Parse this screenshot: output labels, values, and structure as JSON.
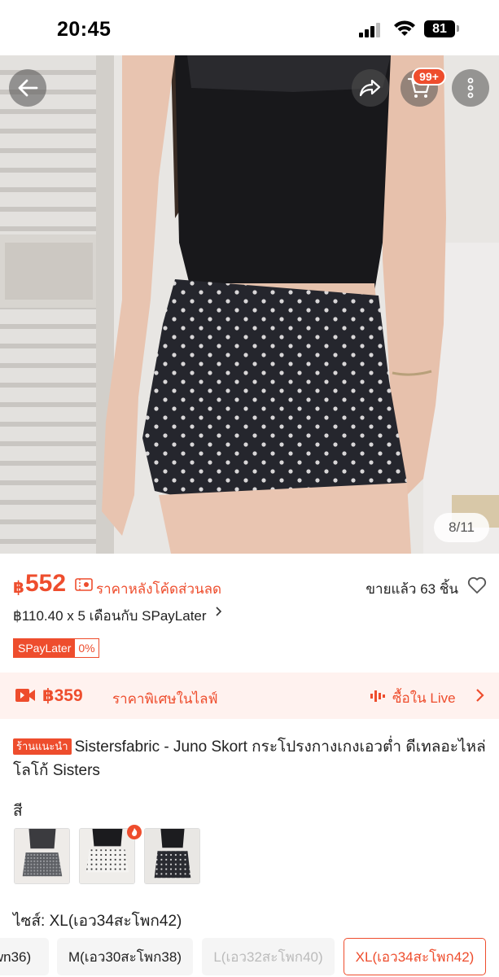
{
  "status_bar": {
    "time": "20:45",
    "battery": "81"
  },
  "header": {
    "back_icon": "arrow-left-icon",
    "share_icon": "share-icon",
    "cart_icon": "cart-icon",
    "cart_badge": "99+",
    "more_icon": "more-vertical-icon"
  },
  "gallery": {
    "indicator": "8/11"
  },
  "price": {
    "currency": "฿",
    "amount": "552",
    "note": "ราคาหลังโค้ดส่วนลด",
    "sold": "ขายแล้ว 63 ชิ้น",
    "installment": "฿110.40 x 5 เดือนกับ SPayLater",
    "spay_label": "SPayLater",
    "spay_rate": "0%"
  },
  "live": {
    "price": "฿359",
    "note": "ราคาพิเศษในไลฟ์",
    "cta": "ซื้อใน Live"
  },
  "product": {
    "shop_tag": "ร้านแนะนำ",
    "title": "Sistersfabric - Juno Skort กระโปรงกางเกงเอวต่ำ ดีเทลอะไหล่โลโก้ Sisters"
  },
  "variation": {
    "color_label": "สี",
    "size_label": "ไซส์: XL(เอว34สะโพก42)",
    "sizes": [
      "wn36)",
      "M(เอว30สะโพก38)",
      "L(เอว32สะโพก40)",
      "XL(เอว34สะโพก42)"
    ]
  },
  "colors": {
    "accent": "#ee4d2d",
    "live_bg": "#fff2ef"
  }
}
